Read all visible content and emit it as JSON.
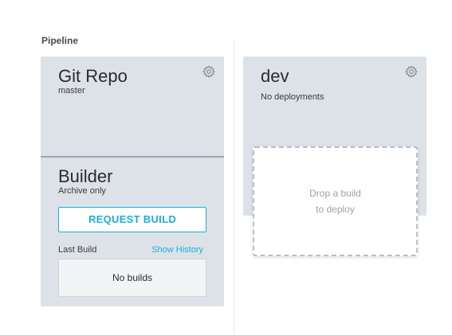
{
  "header": {
    "section_label": "Pipeline"
  },
  "source": {
    "title": "Git Repo",
    "branch": "master",
    "settings_icon": "gear-icon"
  },
  "builder": {
    "title": "Builder",
    "subtitle": "Archive only",
    "request_button_label": "REQUEST BUILD",
    "last_build_label": "Last Build",
    "show_history_label": "Show History",
    "no_builds_text": "No builds"
  },
  "environment": {
    "title": "dev",
    "status": "No deployments",
    "settings_icon": "gear-icon",
    "drop_zone_line1": "Drop a build",
    "drop_zone_line2": "to deploy"
  },
  "colors": {
    "card_background": "#dde2e8",
    "accent": "#1aaed8",
    "divider": "#9ea7b0"
  }
}
